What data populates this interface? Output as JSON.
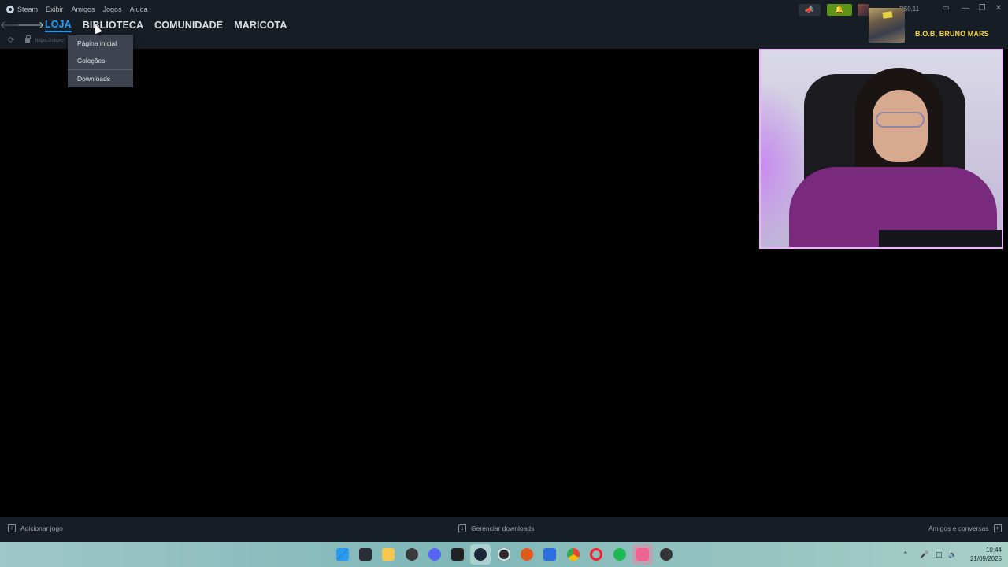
{
  "menubar": {
    "steam": "Steam",
    "items": [
      "Exibir",
      "Amigos",
      "Jogos",
      "Ajuda"
    ]
  },
  "nav": {
    "tabs": [
      {
        "label": "LOJA",
        "active": true
      },
      {
        "label": "BIBLIOTECA",
        "active": false
      },
      {
        "label": "COMUNIDADE",
        "active": false
      },
      {
        "label": "MARICOTA",
        "active": false
      }
    ],
    "url": "https://store"
  },
  "dropdown": {
    "items": [
      "Página inicial",
      "Coleções",
      "Downloads"
    ]
  },
  "account": {
    "balance": "R$0,11"
  },
  "now_playing": "B.O.B, BRUNO MARS",
  "bottombar": {
    "add_game": "Adicionar jogo",
    "manage_downloads": "Gerenciar downloads",
    "friends_chat": "Amigos e conversas"
  },
  "taskbar": {
    "time": "10:44",
    "date": "21/09/2025"
  },
  "colors": {
    "accent": "#1a9fff",
    "notification": "#5c9417",
    "now_playing": "#f3d43a",
    "webcam_border": "#e9b7f7"
  }
}
